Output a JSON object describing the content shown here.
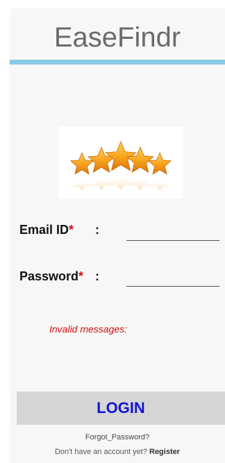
{
  "app": {
    "title": "EaseFindr",
    "logo_icon": "five-stars-icon"
  },
  "form": {
    "email_label": "Email ID",
    "password_label": "Password",
    "required_marker": "*",
    "colon": ":",
    "email_value": "",
    "password_value": "",
    "invalid_message": "Invalid messages:"
  },
  "actions": {
    "login_label": "LOGIN",
    "forgot_password": "Forgot_Password?",
    "no_account_text": "Don't have an account yet?",
    "register_label": "Register"
  },
  "colors": {
    "title_bar": "#89c9e5",
    "required": "#d01010",
    "login_text": "#1414d4",
    "button_bg": "#d6d6d6"
  }
}
